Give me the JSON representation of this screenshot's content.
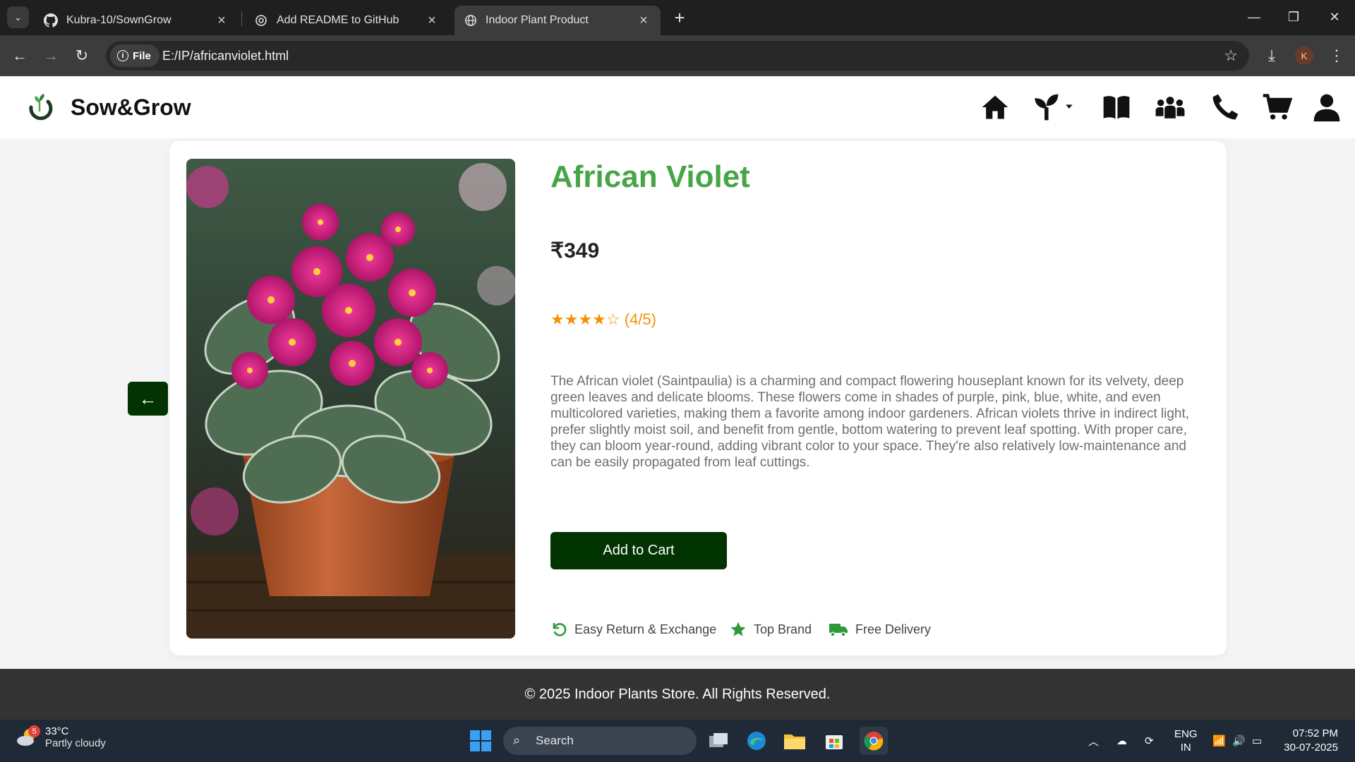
{
  "browser": {
    "tabs": [
      {
        "title": "Kubra-10/SownGrow",
        "icon": "github-icon"
      },
      {
        "title": "Add README to GitHub",
        "icon": "openai-icon"
      },
      {
        "title": "Indoor Plant Product",
        "icon": "globe-icon",
        "active": true
      }
    ],
    "address": {
      "scheme_label": "File",
      "url": "E:/IP/africanviolet.html"
    },
    "profile_initial": "K"
  },
  "site": {
    "brand": "Sow&Grow",
    "nav_icons": [
      "home-icon",
      "seedling-icon",
      "book-icon",
      "community-icon",
      "phone-icon",
      "cart-icon",
      "user-icon"
    ]
  },
  "product": {
    "back_label": "←",
    "title": "African Violet",
    "price": "₹349",
    "rating_stars": "★★★★☆",
    "rating_text": "(4/5)",
    "rating_value": 4,
    "rating_max": 5,
    "description": "The African violet (Saintpaulia) is a charming and compact flowering houseplant known for its velvety, deep green leaves and delicate blooms. These flowers come in shades of purple, pink, blue, white, and even multicolored varieties, making them a favorite among indoor gardeners. African violets thrive in indirect light, prefer slightly moist soil, and benefit from gentle, bottom watering to prevent leaf spotting. With proper care, they can bloom year-round, adding vibrant color to your space. They're also relatively low-maintenance and can be easily propagated from leaf cuttings.",
    "add_to_cart": "Add to Cart",
    "features": [
      {
        "label": "Easy Return & Exchange",
        "icon": "return-icon"
      },
      {
        "label": "Top Brand",
        "icon": "star-icon"
      },
      {
        "label": "Free Delivery",
        "icon": "truck-icon"
      }
    ]
  },
  "footer": {
    "text": "© 2025 Indoor Plants Store. All Rights Reserved."
  },
  "taskbar": {
    "weather_temp": "33°C",
    "weather_cond": "Partly cloudy",
    "weather_badge": "5",
    "search_label": "Search",
    "lang_line1": "ENG",
    "lang_line2": "IN",
    "time": "07:52 PM",
    "date": "30-07-2025"
  },
  "colors": {
    "accent_green": "#46a546",
    "dark_green": "#013401",
    "rating_orange": "#f29200",
    "footer_bg": "#333333"
  }
}
